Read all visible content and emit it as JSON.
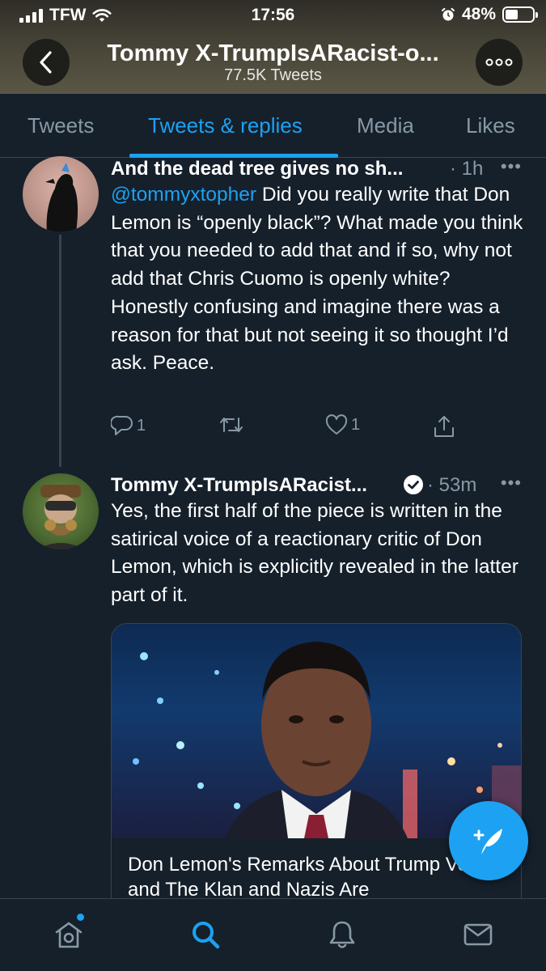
{
  "status_bar": {
    "carrier": "TFW",
    "time": "17:56",
    "battery": "48%",
    "battery_level": 0.48
  },
  "header": {
    "title": "Tommy X-TrumpIsARacist-o...",
    "subtitle": "77.5K Tweets",
    "back_icon": "chevron-left-icon",
    "more_icon": "more-dots-icon"
  },
  "tabs": [
    {
      "label": "Tweets",
      "active": false
    },
    {
      "label": "Tweets & replies",
      "active": true
    },
    {
      "label": "Media",
      "active": false
    },
    {
      "label": "Likes",
      "active": false
    }
  ],
  "tweets": [
    {
      "name": "And the dead tree gives no sh...",
      "time": "· 1h",
      "more": "•••",
      "mention": "@tommyxtopher",
      "text": " Did you really write that Don Lemon is “openly black”? What made you think that you needed to add that and if so, why not add that Chris Cuomo is openly white? Honestly confusing and imagine there was a reason for that but not seeing it so thought I’d ask. Peace.",
      "replies": "1",
      "retweets": "",
      "likes": "1"
    },
    {
      "name": "Tommy X-TrumpIsARacist...",
      "verified": true,
      "time": "· 53m",
      "more": "•••",
      "text": "Yes, the first half of the piece is written in the satirical voice of a reactionary critic of Don Lemon, which is explicitly revealed in the latter part of it.",
      "card": {
        "title": "Don Lemon's Remarks About Trump Voters and The Klan and Nazis Are"
      }
    }
  ],
  "bottom_nav": [
    {
      "icon": "home-icon",
      "active": false,
      "badge": true
    },
    {
      "icon": "search-icon",
      "active": true
    },
    {
      "icon": "bell-icon",
      "active": false
    },
    {
      "icon": "mail-icon",
      "active": false
    }
  ],
  "fab": {
    "icon": "compose-tweet-icon"
  },
  "colors": {
    "background": "#15202b",
    "accent": "#1da1f2",
    "secondary_text": "#8899a6",
    "divider": "#38444d"
  }
}
